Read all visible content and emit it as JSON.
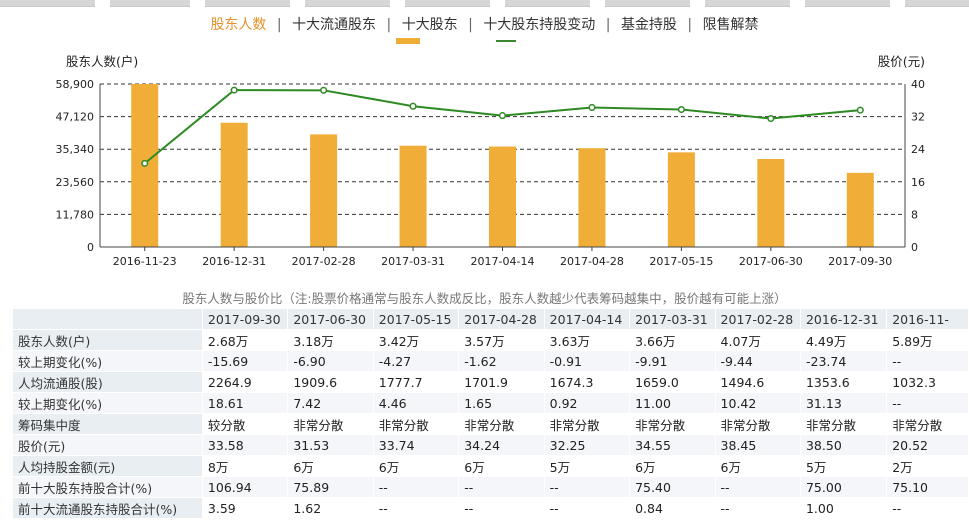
{
  "nav": {
    "tabs": [
      {
        "label": "股东人数",
        "active": true
      },
      {
        "label": "十大流通股东",
        "active": false
      },
      {
        "label": "十大股东",
        "active": false
      },
      {
        "label": "十大股东持股变动",
        "active": false
      },
      {
        "label": "基金持股",
        "active": false
      },
      {
        "label": "限售解禁",
        "active": false
      }
    ],
    "separator": "|"
  },
  "chart_data": {
    "type": "bar+line",
    "ylabel_left": "股东人数(户)",
    "ylabel_right": "股价(元)",
    "left_ticks": [
      "0",
      "11,780",
      "23,560",
      "35,340",
      "47,120",
      "58,900"
    ],
    "ylim_left": [
      0,
      58900
    ],
    "right_ticks": [
      "0",
      "8",
      "16",
      "24",
      "32",
      "40"
    ],
    "ylim_right": [
      0,
      40
    ],
    "categories": [
      "2016-11-23",
      "2016-12-31",
      "2017-02-28",
      "2017-03-31",
      "2017-04-14",
      "2017-04-28",
      "2017-05-15",
      "2017-06-30",
      "2017-09-30"
    ],
    "series": [
      {
        "values": [
          58900,
          44900,
          40700,
          36600,
          36300,
          35700,
          34200,
          31800,
          26800
        ],
        "axis": "left",
        "kind": "bar",
        "color": "#f0ad37"
      },
      {
        "values": [
          20.52,
          38.5,
          38.45,
          34.55,
          32.25,
          34.24,
          33.74,
          31.53,
          33.58
        ],
        "axis": "right",
        "kind": "line",
        "color": "#2d8a22"
      }
    ],
    "grid": true,
    "grid_style": "dashed"
  },
  "caption": "股东人数与股价比（注:股票价格通常与股东人数成反比，股东人数越少代表筹码越集中，股价越有可能上涨）",
  "table": {
    "columns": [
      "2017-09-30",
      "2017-06-30",
      "2017-05-15",
      "2017-04-28",
      "2017-04-14",
      "2017-03-31",
      "2017-02-28",
      "2016-12-31",
      "2016-11-"
    ],
    "rows": [
      {
        "label": "股东人数(户)",
        "cells": [
          "2.68万",
          "3.18万",
          "3.42万",
          "3.57万",
          "3.63万",
          "3.66万",
          "4.07万",
          "4.49万",
          "5.89万"
        ]
      },
      {
        "label": "较上期变化(%)",
        "cells": [
          "-15.69",
          "-6.90",
          "-4.27",
          "-1.62",
          "-0.91",
          "-9.91",
          "-9.44",
          "-23.74",
          "--"
        ]
      },
      {
        "label": "人均流通股(股)",
        "cells": [
          "2264.9",
          "1909.6",
          "1777.7",
          "1701.9",
          "1674.3",
          "1659.0",
          "1494.6",
          "1353.6",
          "1032.3"
        ]
      },
      {
        "label": "较上期变化(%)",
        "cells": [
          "18.61",
          "7.42",
          "4.46",
          "1.65",
          "0.92",
          "11.00",
          "10.42",
          "31.13",
          "--"
        ]
      },
      {
        "label": "筹码集中度",
        "cells": [
          "较分散",
          "非常分散",
          "非常分散",
          "非常分散",
          "非常分散",
          "非常分散",
          "非常分散",
          "非常分散",
          "非常分散"
        ]
      },
      {
        "label": "股价(元)",
        "cells": [
          "33.58",
          "31.53",
          "33.74",
          "34.24",
          "32.25",
          "34.55",
          "38.45",
          "38.50",
          "20.52"
        ]
      },
      {
        "label": "人均持股金额(元)",
        "cells": [
          "8万",
          "6万",
          "6万",
          "6万",
          "5万",
          "6万",
          "6万",
          "5万",
          "2万"
        ]
      },
      {
        "label": "前十大股东持股合计(%)",
        "cells": [
          "106.94",
          "75.89",
          "--",
          "--",
          "--",
          "75.40",
          "--",
          "75.00",
          "75.10"
        ]
      },
      {
        "label": "前十大流通股东持股合计(%)",
        "cells": [
          "3.59",
          "1.62",
          "--",
          "--",
          "--",
          "0.84",
          "--",
          "1.00",
          "--"
        ]
      }
    ]
  },
  "colors": {
    "bar": "#f0ad37",
    "line": "#2d8a22",
    "active_tab": "#e8912b",
    "table_header_bg": "#e9eef3",
    "table_alt_bg": "#f4f6f9"
  }
}
